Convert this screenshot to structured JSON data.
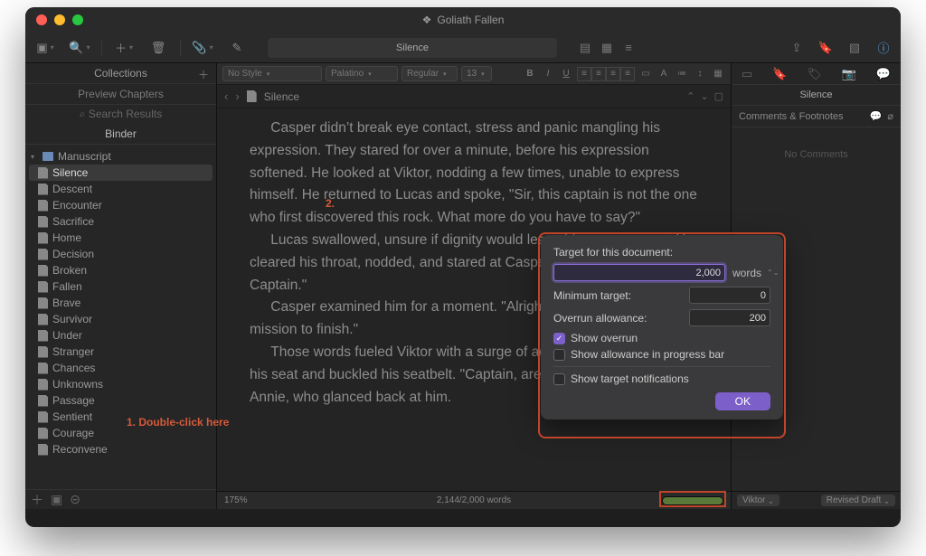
{
  "window": {
    "title": "Goliath Fallen"
  },
  "toolbar": {
    "doc_pill": "Silence"
  },
  "binder": {
    "tab_label": "Collections",
    "preview_label": "Preview Chapters",
    "search_label": "Search Results",
    "header": "Binder",
    "root": "Manuscript",
    "items": [
      "Silence",
      "Descent",
      "Encounter",
      "Sacrifice",
      "Home",
      "Decision",
      "Broken",
      "Fallen",
      "Brave",
      "Survivor",
      "Under",
      "Stranger",
      "Chances",
      "Unknowns",
      "Passage",
      "Sentient",
      "Courage",
      "Reconvene"
    ]
  },
  "format_bar": {
    "style": "No Style",
    "font": "Palatino",
    "weight": "Regular",
    "size": "13"
  },
  "doc_header": {
    "title": "Silence"
  },
  "prose": {
    "p1": "Casper didn’t break eye contact, stress and panic mangling his expression. They stared for over a minute, before his expression softened. He looked at Viktor, nodding a few times, unable to express himself. He returned to Lucas and spoke, \"Sir, this captain is not the one who first discovered this rock. What more do you have to say?\"",
    "p2": "Lucas swallowed, unsure if dignity would leave him any moment. He cleared his throat, nodded, and stared at Casper right back. \"That is all, Captain.\"",
    "p3": "Casper examined him for a moment. \"Alright, let’s go. We have a mission to finish.\"",
    "p4": "Those words fueled Viktor with a surge of adrenaline. He returned to his seat and buckled his seatbelt. \"Captain, are we ready?\" he said to Annie, who glanced back at him."
  },
  "editor_footer": {
    "zoom": "175%",
    "wordcount": "2,144/2,000 words",
    "progress_pct": 100
  },
  "inspector": {
    "title": "Silence",
    "section": "Comments & Footnotes",
    "empty": "No Comments",
    "label_select": "Viktor",
    "status_select": "Revised Draft"
  },
  "dialog": {
    "heading": "Target for this document:",
    "target_value": "2,000",
    "unit": "words",
    "min_label": "Minimum target:",
    "min_value": "0",
    "overrun_label": "Overrun allowance:",
    "overrun_value": "200",
    "chk_overrun": "Show overrun",
    "chk_allowance": "Show allowance in progress bar",
    "chk_notify": "Show target notifications",
    "ok": "OK"
  },
  "annot": {
    "a1": "1. Double-click here",
    "a2": "2."
  }
}
